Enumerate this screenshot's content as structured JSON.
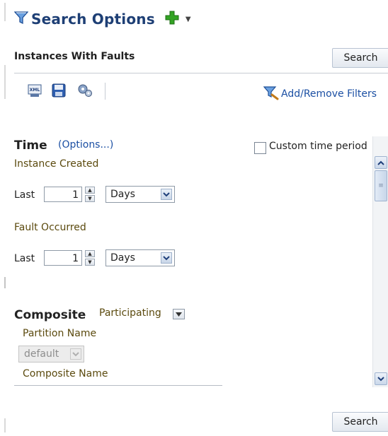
{
  "header": {
    "title": "Search Options"
  },
  "section": {
    "label": "Instances With Faults",
    "search_button": "Search"
  },
  "toolbar": {
    "icons": [
      "xml-icon",
      "save-icon",
      "settings-icon"
    ],
    "filters_link": "Add/Remove Filters"
  },
  "time": {
    "title": "Time",
    "options_link": "(Options...)",
    "custom_period_label": "Custom time period",
    "custom_period_checked": false,
    "instance_created": {
      "label": "Instance Created",
      "last_label": "Last",
      "value": "1",
      "unit": "Days"
    },
    "fault_occurred": {
      "label": "Fault Occurred",
      "last_label": "Last",
      "value": "1",
      "unit": "Days"
    }
  },
  "composite": {
    "title": "Composite",
    "mode": "Participating",
    "partition_label": "Partition Name",
    "partition_value": "default",
    "composite_name_label": "Composite Name"
  },
  "footer": {
    "search_button": "Search"
  },
  "colors": {
    "title": "#1e3f75",
    "link": "#1b4fa3",
    "olive_label": "#5b4a0e",
    "accent_green": "#2f9e23"
  }
}
